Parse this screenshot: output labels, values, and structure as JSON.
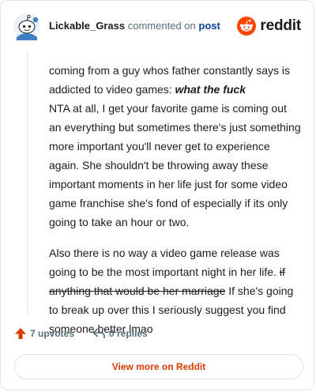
{
  "header": {
    "username": "Lickable_Grass",
    "action_text": "commented on",
    "target_link": "post",
    "brand": "reddit"
  },
  "comment": {
    "p1_text": "coming from a guy whos father constantly says is addicted to video games: ",
    "p1_emph": "what the fuck",
    "p1_rest": "NTA at all, I get your favorite game is coming out an everything but sometimes there's just something more important you'll never get to experience again. She shouldn't be throwing away these important moments in her life just for some video game franchise she's fond of especially if its only going to take an hour or two.",
    "p2_text": "Also there is no way a video game release was going to be the most important night in her life. ",
    "p2_struck": "if anything that would be her marriage",
    "p2_rest": " If she's going to break up over this I seriously suggest you find someone better lmao"
  },
  "footer": {
    "upvotes": "7 upvotes",
    "replies": "0 replies",
    "view_more": "View more on Reddit"
  },
  "colors": {
    "upvote": "#d93a00",
    "reddit_orange": "#ff4500",
    "link": "#0a449b"
  },
  "icons": [
    "avatar-snoo-icon",
    "reddit-logo-icon",
    "upvote-arrow-icon",
    "reply-arrow-icon"
  ]
}
